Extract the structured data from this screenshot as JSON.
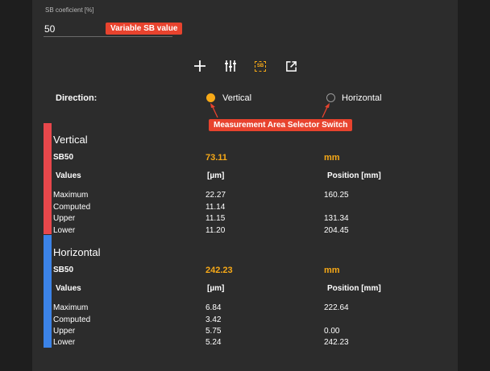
{
  "colors": {
    "accent": "#f7a917",
    "callout": "#e8432e",
    "vertical_bar": "#e8474b",
    "horizontal_bar": "#3b83e8"
  },
  "sb": {
    "label": "SB coeficient [%]",
    "value": "50",
    "callout": "Variable SB value"
  },
  "toolbar": {
    "icons": [
      "plus-icon",
      "sliders-icon",
      "sb-icon",
      "open-external-icon"
    ],
    "sb_icon_text": "SB"
  },
  "direction": {
    "label": "Direction:",
    "vertical_label": "Vertical",
    "horizontal_label": "Horizontal",
    "selected": "Vertical",
    "callout": "Measurement Area Selector Switch"
  },
  "vertical": {
    "title": "Vertical",
    "sb_label": "SB50",
    "sb_value": "73.11",
    "sb_unit": "mm",
    "col_values": "Values",
    "col_um": "[µm]",
    "col_position": "Position [mm]",
    "rows": [
      {
        "label": "Maximum",
        "um": "22.27",
        "pos": "160.25"
      },
      {
        "label": "Computed",
        "um": "11.14",
        "pos": ""
      },
      {
        "label": "Upper",
        "um": "11.15",
        "pos": "131.34"
      },
      {
        "label": "Lower",
        "um": "11.20",
        "pos": "204.45"
      }
    ]
  },
  "horizontal": {
    "title": "Horizontal",
    "sb_label": "SB50",
    "sb_value": "242.23",
    "sb_unit": "mm",
    "col_values": "Values",
    "col_um": "[µm]",
    "col_position": "Position [mm]",
    "rows": [
      {
        "label": "Maximum",
        "um": "6.84",
        "pos": "222.64"
      },
      {
        "label": "Computed",
        "um": "3.42",
        "pos": ""
      },
      {
        "label": "Upper",
        "um": "5.75",
        "pos": "0.00"
      },
      {
        "label": "Lower",
        "um": "5.24",
        "pos": "242.23"
      }
    ]
  }
}
